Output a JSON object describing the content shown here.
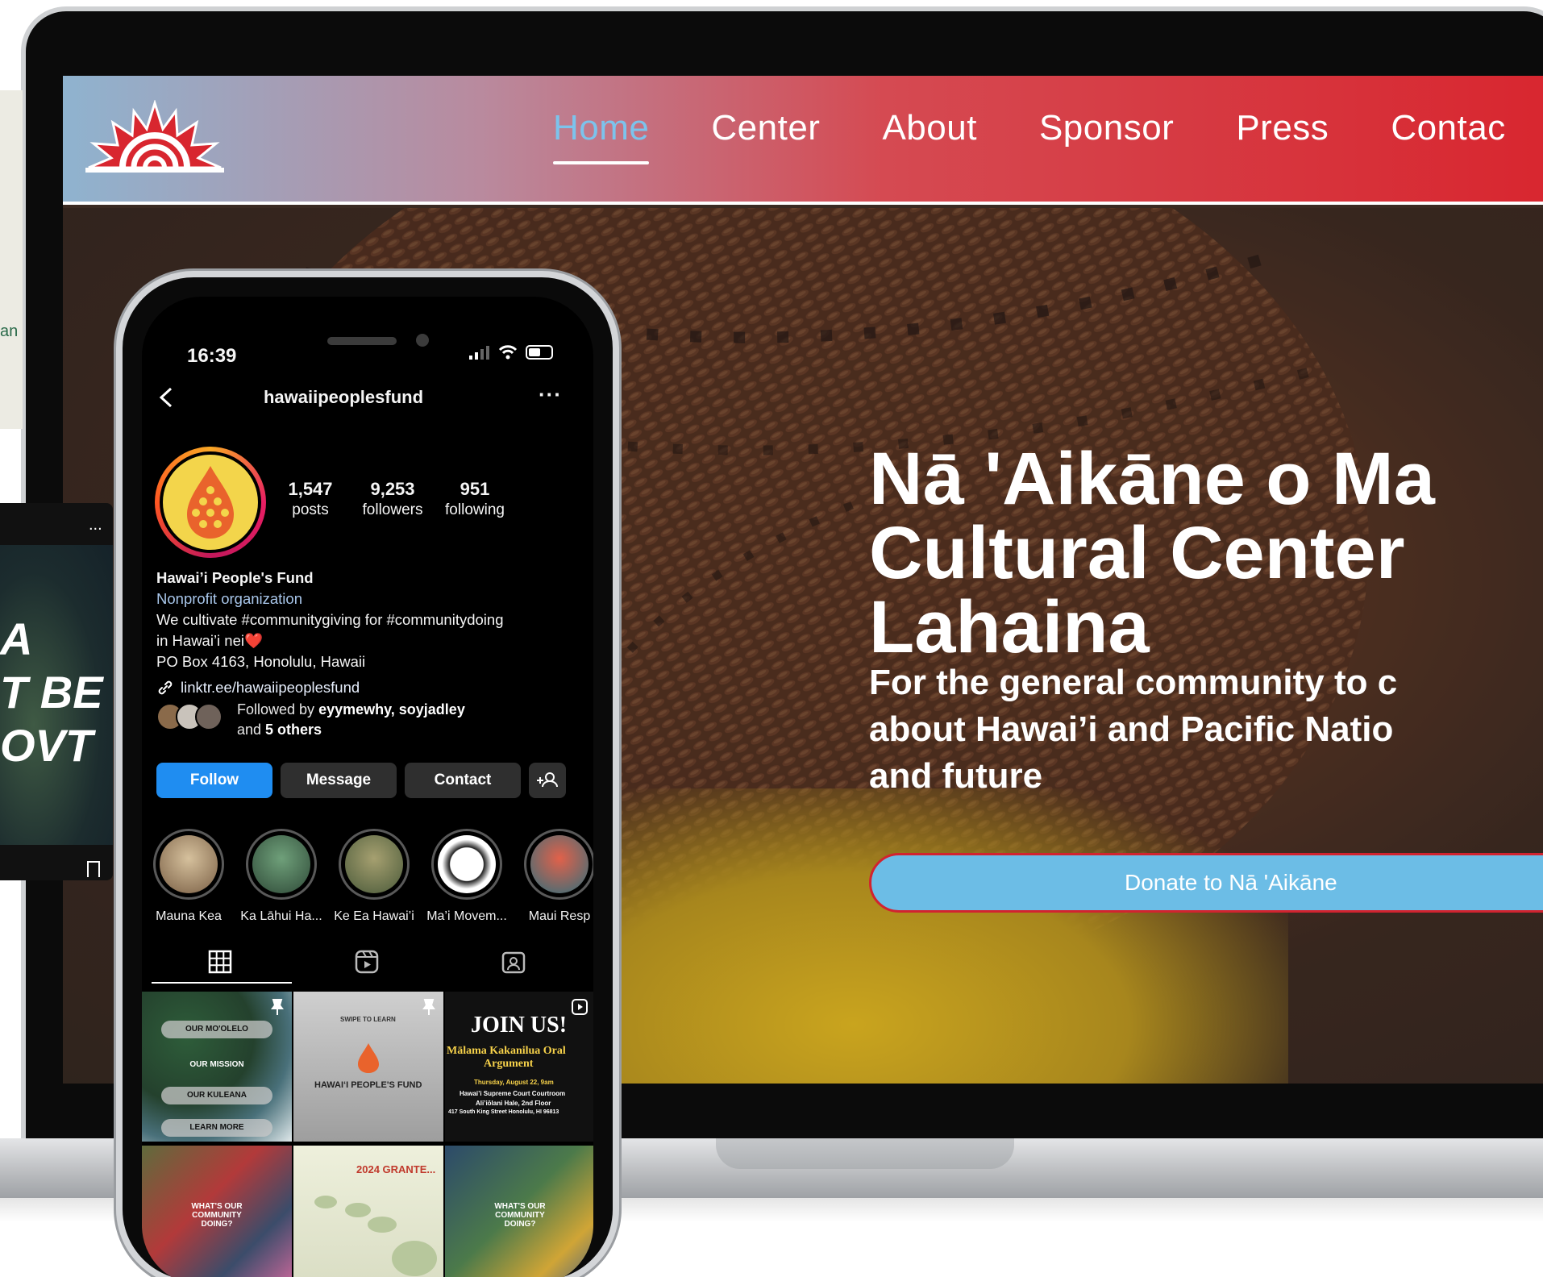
{
  "website": {
    "nav": [
      {
        "label": "Home",
        "active": true
      },
      {
        "label": "Center"
      },
      {
        "label": "About"
      },
      {
        "label": "Sponsor"
      },
      {
        "label": "Press"
      },
      {
        "label": "Contac"
      }
    ],
    "hero_title_lines": [
      "Nā 'Aikāne o Ma",
      "Cultural Center",
      "Lahaina"
    ],
    "hero_subtitle_lines": [
      "For the general community to c",
      "about Hawai’i and Pacific Natio",
      "and future"
    ],
    "donate_label": "Donate to Nā 'Aikāne",
    "colors": {
      "nav_start": "#8fb3cf",
      "nav_end": "#d8262f",
      "active_link": "#7cc3ec",
      "donate_bg": "#6cbde6",
      "donate_border": "#d2232f"
    }
  },
  "left_cards": {
    "bg_text": "an",
    "post_text_lines": [
      "A",
      "T BE",
      "OVT"
    ],
    "post_dots": "...",
    "bookmark_icon": "bookmark-icon"
  },
  "phone": {
    "status": {
      "time": "16:39"
    },
    "profile": {
      "username": "hawaiipeoplesfund",
      "stats": [
        {
          "num": "1,547",
          "label": "posts"
        },
        {
          "num": "9,253",
          "label": "followers"
        },
        {
          "num": "951",
          "label": "following"
        }
      ],
      "name": "Hawai’i People's Fund",
      "category": "Nonprofit organization",
      "bio_line1": "We cultivate #communitygiving for #communitydoing",
      "bio_line2": "in Hawai’i nei❤️",
      "address": "PO Box 4163, Honolulu, Hawaii",
      "link": "linktr.ee/hawaiipeoplesfund",
      "followed_by_prefix": "Followed by ",
      "followed_by_names": "eyymewhy, soyjadley",
      "followed_by_suffix_prefix": "and ",
      "followed_by_others": "5 others",
      "buttons": {
        "follow": "Follow",
        "message": "Message",
        "contact": "Contact"
      }
    },
    "highlights": [
      {
        "label": "Mauna Kea",
        "color": "#c9b08a"
      },
      {
        "label": "Ka Lāhui Ha...",
        "color": "#4f7a5a"
      },
      {
        "label": "Ke Ea Hawai’i",
        "color": "#8a7f4a"
      },
      {
        "label": "Ma’i Movem...",
        "color": "#ffffff"
      },
      {
        "label": "Maui Resp",
        "color": "#3a7c8a"
      }
    ],
    "posts": {
      "p1": [
        "OUR MO'OLELO",
        "OUR MISSION",
        "OUR KULEANA",
        "LEARN MORE"
      ],
      "p2_title": "HAWAI‘I PEOPLE'S FUND",
      "p2_top": "SWIPE TO LEARN",
      "p3_title": "JOIN US!",
      "p3_sub1": "Mālama Kakanilua Oral",
      "p3_sub2": "Argument",
      "p3_date": "Thursday, August 22, 9am",
      "p3_loc1": "Hawai’i Supreme Court Courtroom",
      "p3_loc2": "Ali’iōlani Hale, 2nd Floor",
      "p3_loc3": "417 South King Street Honolulu, HI 96813",
      "p4": "WHAT'S OUR COMMUNITY DOING?",
      "p5": "2024 GRANTE...",
      "p6": "WHAT'S OUR COMMUNITY DOING?"
    }
  }
}
